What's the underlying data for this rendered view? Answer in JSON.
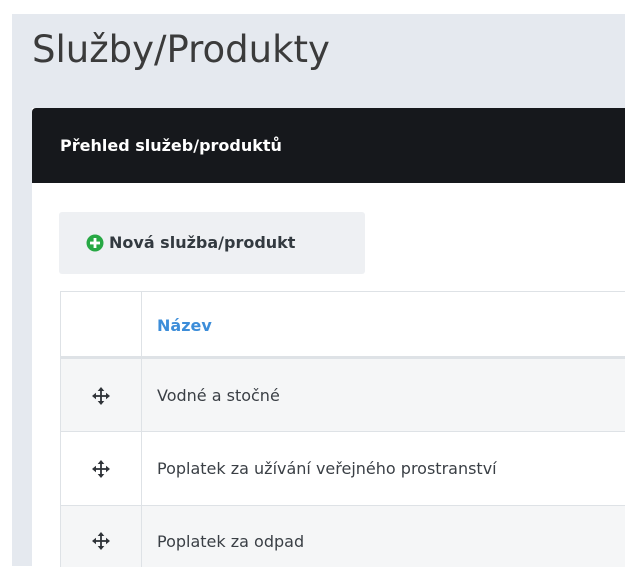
{
  "page": {
    "title": "Služby/Produkty"
  },
  "panel": {
    "title": "Přehled služeb/produktů"
  },
  "toolbar": {
    "new_button_label": "Nová služba/produkt",
    "new_button_icon": "plus-circle-icon"
  },
  "table": {
    "columns": [
      "",
      "Název"
    ],
    "rows": [
      {
        "name": "Vodné a stočné",
        "handle_icon": "move-arrows-icon"
      },
      {
        "name": "Poplatek za užívání veřejného prostranství",
        "handle_icon": "move-arrows-icon"
      },
      {
        "name": "Poplatek za odpad",
        "handle_icon": "move-arrows-icon"
      }
    ]
  },
  "colors": {
    "header_bg": "#16181c",
    "content_bg": "#e5e9ef",
    "accent_link": "#3c8dd9",
    "success_green": "#27a844",
    "button_bg": "#eef0f3"
  }
}
